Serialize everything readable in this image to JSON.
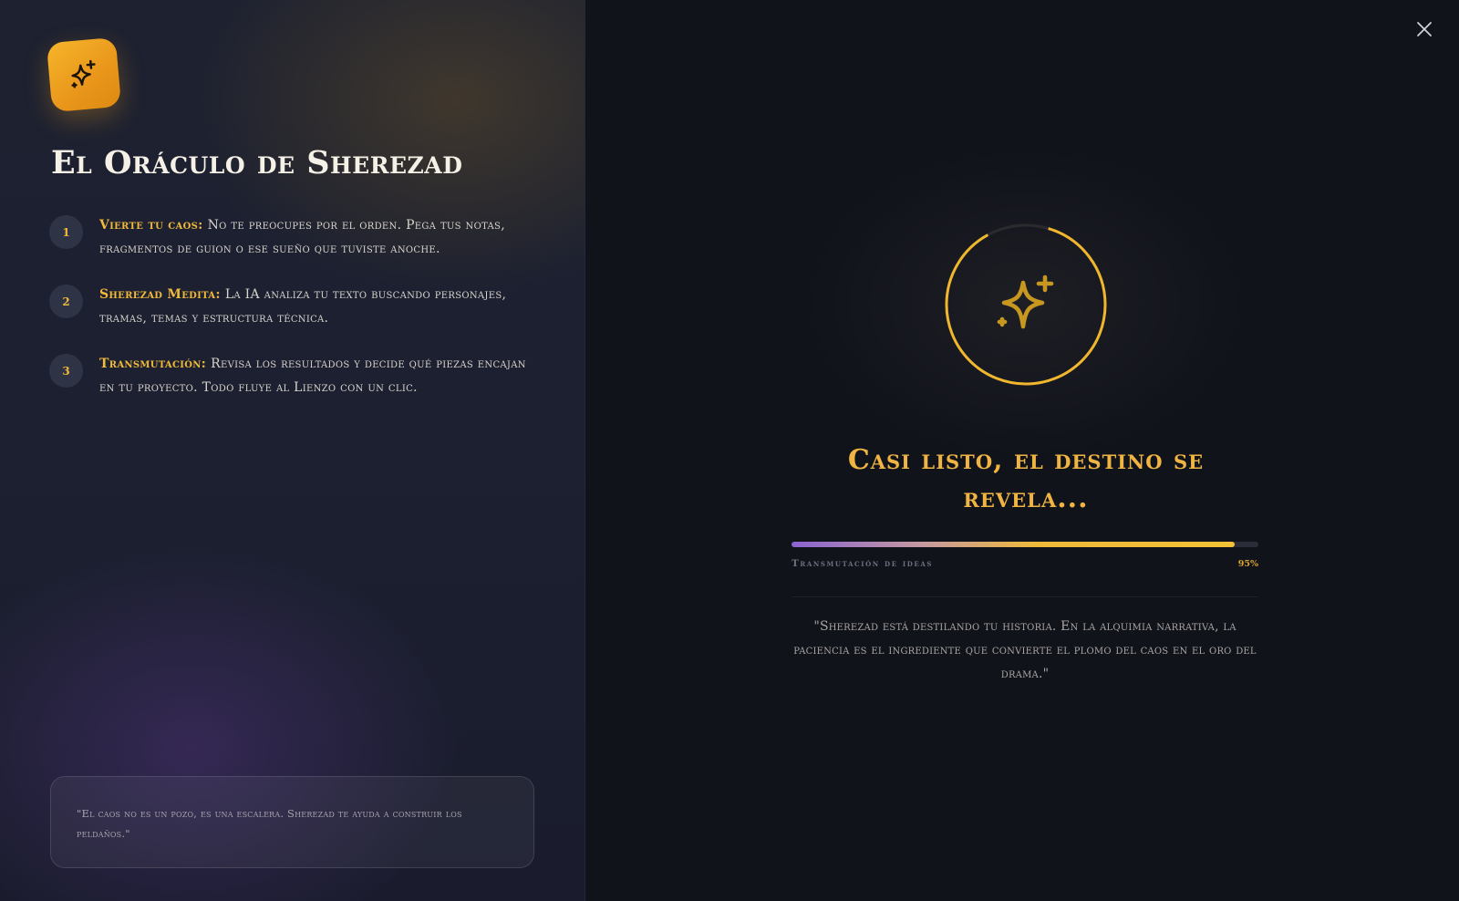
{
  "window": {
    "close_icon": "close-icon"
  },
  "sidebar": {
    "logo_icon": "sparkles-icon",
    "title": "El Oráculo de Sherezad",
    "steps": [
      {
        "number": "1",
        "label": "Vierte tu caos:",
        "text": "No te preocupes por el orden. Pega tus notas, fragmentos de guion o ese sueño que tuviste anoche."
      },
      {
        "number": "2",
        "label": "Sherezad Medita:",
        "text": "La IA analiza tu texto buscando personajes, tramas, temas y estructura técnica."
      },
      {
        "number": "3",
        "label": "Transmutación:",
        "text": "Revisa los resultados y decide qué piezas encajan en tu proyecto. Todo fluye al Lienzo con un clic."
      }
    ],
    "quote": "\"El caos no es un pozo, es una escalera. Sherezad te ayuda a construir los peldaños.\""
  },
  "main": {
    "spinner_icon": "sparkles-icon",
    "status_title": "Casi listo, el destino se revela...",
    "progress": {
      "label": "Transmutación de ideas",
      "percent_label": "95%",
      "value": 0.95
    },
    "quote": "\"Sherezad está destilando tu historia. En la alquimia narrativa, la paciencia es el ingrediente que convierte el plomo del caos en el oro del drama.\""
  },
  "colors": {
    "accent_gold": "#f0b93a",
    "logo_orange": "#f2a623",
    "progress_start": "#8a63d2",
    "panel_dark": "#11131b"
  }
}
